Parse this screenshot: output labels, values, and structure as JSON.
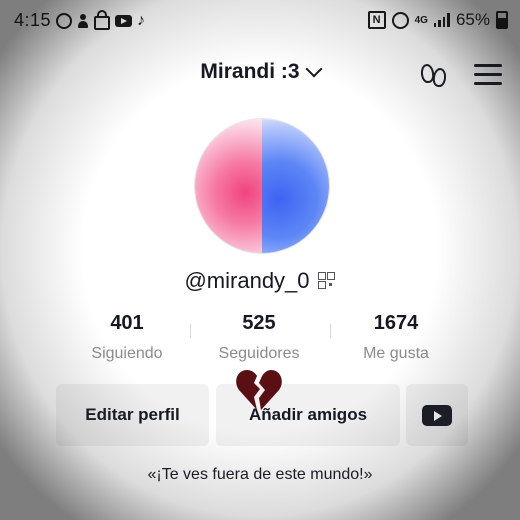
{
  "status_bar": {
    "time": "4:15",
    "network": "4G",
    "battery": "65%"
  },
  "header": {
    "title": "Mirandi :3"
  },
  "profile": {
    "handle": "@mirandy_0"
  },
  "stats": [
    {
      "value": "401",
      "label": "Siguiendo"
    },
    {
      "value": "525",
      "label": "Seguidores"
    },
    {
      "value": "1674",
      "label": "Me gusta"
    }
  ],
  "actions": {
    "edit_profile": "Editar perfil",
    "add_friends": "Añadir amigos"
  },
  "bio": "«¡Te ves fuera de este mundo!»",
  "colors": {
    "heart": "#5a0f12",
    "avatar_pink": "#f0447f",
    "avatar_blue": "#3f63f2",
    "button_bg": "#f1f1f2",
    "muted_text": "#8a8b91"
  }
}
